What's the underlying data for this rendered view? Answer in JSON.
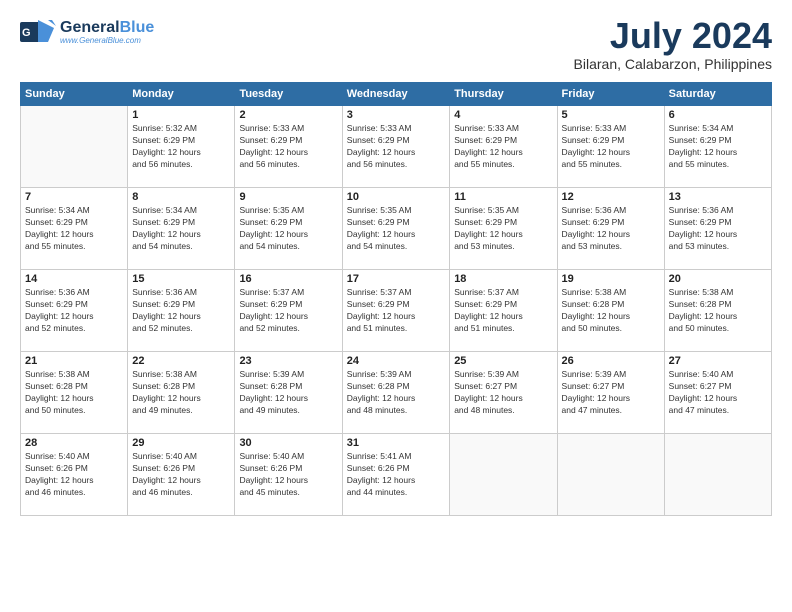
{
  "logo": {
    "line1": "General",
    "line2": "Blue",
    "tagline": "www.GeneralBlue.com"
  },
  "title": "July 2024",
  "location": "Bilaran, Calabarzon, Philippines",
  "days_header": [
    "Sunday",
    "Monday",
    "Tuesday",
    "Wednesday",
    "Thursday",
    "Friday",
    "Saturday"
  ],
  "weeks": [
    [
      {
        "day": "",
        "info": ""
      },
      {
        "day": "1",
        "info": "Sunrise: 5:32 AM\nSunset: 6:29 PM\nDaylight: 12 hours\nand 56 minutes."
      },
      {
        "day": "2",
        "info": "Sunrise: 5:33 AM\nSunset: 6:29 PM\nDaylight: 12 hours\nand 56 minutes."
      },
      {
        "day": "3",
        "info": "Sunrise: 5:33 AM\nSunset: 6:29 PM\nDaylight: 12 hours\nand 56 minutes."
      },
      {
        "day": "4",
        "info": "Sunrise: 5:33 AM\nSunset: 6:29 PM\nDaylight: 12 hours\nand 55 minutes."
      },
      {
        "day": "5",
        "info": "Sunrise: 5:33 AM\nSunset: 6:29 PM\nDaylight: 12 hours\nand 55 minutes."
      },
      {
        "day": "6",
        "info": "Sunrise: 5:34 AM\nSunset: 6:29 PM\nDaylight: 12 hours\nand 55 minutes."
      }
    ],
    [
      {
        "day": "7",
        "info": "Sunrise: 5:34 AM\nSunset: 6:29 PM\nDaylight: 12 hours\nand 55 minutes."
      },
      {
        "day": "8",
        "info": "Sunrise: 5:34 AM\nSunset: 6:29 PM\nDaylight: 12 hours\nand 54 minutes."
      },
      {
        "day": "9",
        "info": "Sunrise: 5:35 AM\nSunset: 6:29 PM\nDaylight: 12 hours\nand 54 minutes."
      },
      {
        "day": "10",
        "info": "Sunrise: 5:35 AM\nSunset: 6:29 PM\nDaylight: 12 hours\nand 54 minutes."
      },
      {
        "day": "11",
        "info": "Sunrise: 5:35 AM\nSunset: 6:29 PM\nDaylight: 12 hours\nand 53 minutes."
      },
      {
        "day": "12",
        "info": "Sunrise: 5:36 AM\nSunset: 6:29 PM\nDaylight: 12 hours\nand 53 minutes."
      },
      {
        "day": "13",
        "info": "Sunrise: 5:36 AM\nSunset: 6:29 PM\nDaylight: 12 hours\nand 53 minutes."
      }
    ],
    [
      {
        "day": "14",
        "info": "Sunrise: 5:36 AM\nSunset: 6:29 PM\nDaylight: 12 hours\nand 52 minutes."
      },
      {
        "day": "15",
        "info": "Sunrise: 5:36 AM\nSunset: 6:29 PM\nDaylight: 12 hours\nand 52 minutes."
      },
      {
        "day": "16",
        "info": "Sunrise: 5:37 AM\nSunset: 6:29 PM\nDaylight: 12 hours\nand 52 minutes."
      },
      {
        "day": "17",
        "info": "Sunrise: 5:37 AM\nSunset: 6:29 PM\nDaylight: 12 hours\nand 51 minutes."
      },
      {
        "day": "18",
        "info": "Sunrise: 5:37 AM\nSunset: 6:29 PM\nDaylight: 12 hours\nand 51 minutes."
      },
      {
        "day": "19",
        "info": "Sunrise: 5:38 AM\nSunset: 6:28 PM\nDaylight: 12 hours\nand 50 minutes."
      },
      {
        "day": "20",
        "info": "Sunrise: 5:38 AM\nSunset: 6:28 PM\nDaylight: 12 hours\nand 50 minutes."
      }
    ],
    [
      {
        "day": "21",
        "info": "Sunrise: 5:38 AM\nSunset: 6:28 PM\nDaylight: 12 hours\nand 50 minutes."
      },
      {
        "day": "22",
        "info": "Sunrise: 5:38 AM\nSunset: 6:28 PM\nDaylight: 12 hours\nand 49 minutes."
      },
      {
        "day": "23",
        "info": "Sunrise: 5:39 AM\nSunset: 6:28 PM\nDaylight: 12 hours\nand 49 minutes."
      },
      {
        "day": "24",
        "info": "Sunrise: 5:39 AM\nSunset: 6:28 PM\nDaylight: 12 hours\nand 48 minutes."
      },
      {
        "day": "25",
        "info": "Sunrise: 5:39 AM\nSunset: 6:27 PM\nDaylight: 12 hours\nand 48 minutes."
      },
      {
        "day": "26",
        "info": "Sunrise: 5:39 AM\nSunset: 6:27 PM\nDaylight: 12 hours\nand 47 minutes."
      },
      {
        "day": "27",
        "info": "Sunrise: 5:40 AM\nSunset: 6:27 PM\nDaylight: 12 hours\nand 47 minutes."
      }
    ],
    [
      {
        "day": "28",
        "info": "Sunrise: 5:40 AM\nSunset: 6:26 PM\nDaylight: 12 hours\nand 46 minutes."
      },
      {
        "day": "29",
        "info": "Sunrise: 5:40 AM\nSunset: 6:26 PM\nDaylight: 12 hours\nand 46 minutes."
      },
      {
        "day": "30",
        "info": "Sunrise: 5:40 AM\nSunset: 6:26 PM\nDaylight: 12 hours\nand 45 minutes."
      },
      {
        "day": "31",
        "info": "Sunrise: 5:41 AM\nSunset: 6:26 PM\nDaylight: 12 hours\nand 44 minutes."
      },
      {
        "day": "",
        "info": ""
      },
      {
        "day": "",
        "info": ""
      },
      {
        "day": "",
        "info": ""
      }
    ]
  ]
}
